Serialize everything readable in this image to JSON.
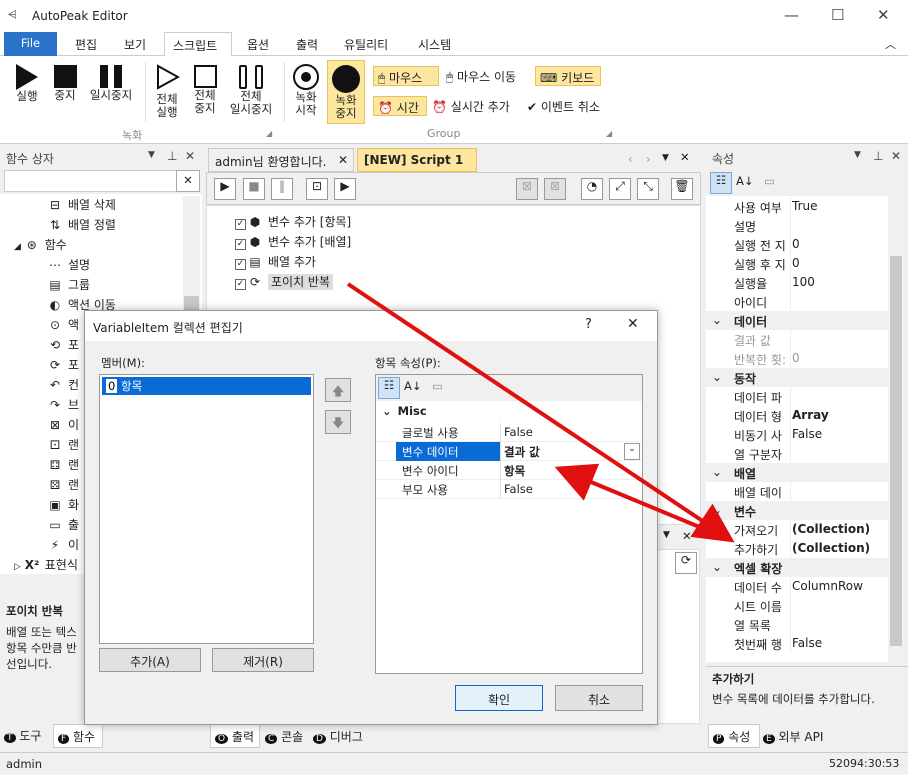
{
  "app": {
    "title": "AutoPeak Editor"
  },
  "menu": {
    "file": "File",
    "items": [
      "편집",
      "보기",
      "스크립트",
      "옵션",
      "출력",
      "유틸리티",
      "시스템"
    ]
  },
  "ribbon": {
    "run": "실행",
    "stop": "중지",
    "pause": "일시중지",
    "run_all": "전체\n실행",
    "stop_all": "전체\n중지",
    "pause_all": "전체\n일시중지",
    "rec_start": "녹화\n시작",
    "rec_stop": "녹화\n중지",
    "mouse": "마우스",
    "mouse_move": "마우스 이동",
    "keyboard": "키보드",
    "time": "시간",
    "realtime": "실시간 추가",
    "event_cancel": "이벤트 취소",
    "group_rec": "녹화",
    "group_group": "Group"
  },
  "left_pane": {
    "title": "함수 상자",
    "items": [
      "배열 삭제",
      "배열 정렬",
      "함수",
      "설명",
      "그룹",
      "액션 이동",
      "액",
      "포",
      "포",
      "컨",
      "브",
      "이",
      "랜",
      "랜",
      "랜",
      "화",
      "출",
      "이",
      "표현식"
    ],
    "desc_title": "포이치 반복",
    "desc_text": "배열 또는 텍스\n항목 수만큼 반\n선입니다.",
    "tabs": [
      "도구",
      "함수"
    ]
  },
  "doc_tabs": [
    "admin님 환영합니다.",
    "[NEW] Script 1"
  ],
  "script": [
    "변수 추가 [항목]",
    "변수 추가 [배열]",
    "배열 추가",
    "포이치 반복"
  ],
  "bottom_tabs": [
    "출력",
    "콘솔",
    "디버그"
  ],
  "right_pane": {
    "title": "속성",
    "rows": [
      [
        "사용 여부",
        "True",
        0
      ],
      [
        "설명",
        "",
        0
      ],
      [
        "실행 전 지",
        "0",
        0
      ],
      [
        "실행 후 지",
        "0",
        0
      ],
      [
        "실행율",
        "100",
        0
      ],
      [
        "아이디",
        "",
        0
      ],
      [
        "데이터",
        "",
        1
      ],
      [
        "결과 값",
        "",
        2
      ],
      [
        "반복한 횟:",
        "0",
        2
      ],
      [
        "동작",
        "",
        1
      ],
      [
        "데이터 파",
        "",
        0
      ],
      [
        "데이터 형",
        "Array",
        3
      ],
      [
        "비동기 사",
        "False",
        0
      ],
      [
        "열 구분자",
        "",
        0
      ],
      [
        "배열",
        "",
        1
      ],
      [
        "배열 데이",
        "",
        0
      ],
      [
        "변수",
        "",
        1
      ],
      [
        "가져오기",
        "(Collection)",
        3
      ],
      [
        "추가하기",
        "(Collection)",
        3
      ],
      [
        "엑셀 확장",
        "",
        1
      ],
      [
        "데이터 수",
        "ColumnRow",
        0
      ],
      [
        "시트 이름",
        "",
        0
      ],
      [
        "열 목록",
        "",
        0
      ],
      [
        "첫번째 행",
        "False",
        0
      ]
    ],
    "desc_title": "추가하기",
    "desc_text": "변수 목록에 데이터를 추가합니다.",
    "tabs": [
      "속성",
      "외부 API"
    ]
  },
  "status": {
    "user": "admin",
    "time": "52094:30:53"
  },
  "dialog": {
    "title": "VariableItem 컬렉션 편집기",
    "members_label": "멤버(M):",
    "member_item": "항목",
    "props_label": "항목 속성(P):",
    "category": "Misc",
    "props": [
      [
        "글로벌 사용",
        "False"
      ],
      [
        "변수 데이터",
        "결과 값"
      ],
      [
        "변수 아이디",
        "항목"
      ],
      [
        "부모 사용",
        "False"
      ]
    ],
    "add": "추가(A)",
    "remove": "제거(R)",
    "ok": "확인",
    "cancel": "취소",
    "help": "?",
    "close": "✕"
  },
  "colors": {
    "accent": "#2b73c8",
    "arrow": "#e01010",
    "highlight": "#fde7a0"
  }
}
